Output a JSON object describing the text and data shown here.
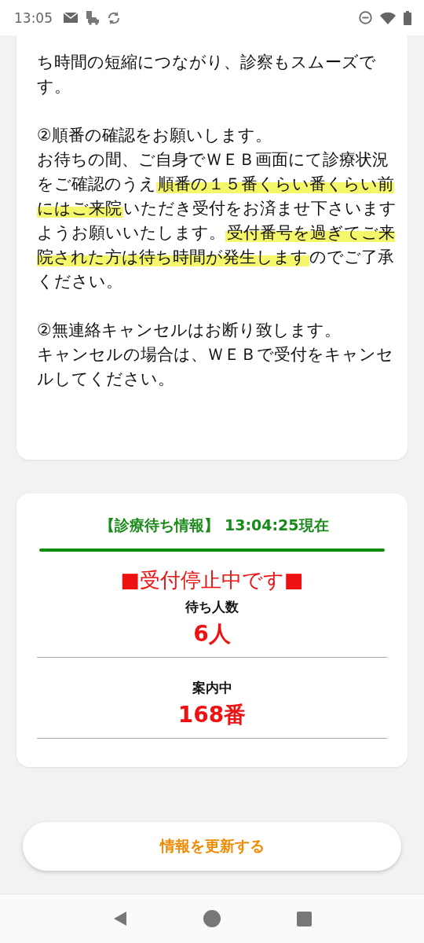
{
  "status_bar": {
    "time": "13:05"
  },
  "notice": {
    "blocks": [
      [
        {
          "segments": [
            {
              "text": "ち時間の短縮につながり、診察もスムーズです。",
              "highlighted": false
            }
          ]
        }
      ],
      [
        {
          "segments": [
            {
              "text": "②順番の確認をお願いします。",
              "highlighted": false
            }
          ]
        },
        {
          "segments": [
            {
              "text": "お待ちの間、ご自身でＷＥＢ画面にて診療状況をご確認のうえ",
              "highlighted": false
            },
            {
              "text": "順番の１５番くらい番くらい前にはご来院",
              "highlighted": true
            },
            {
              "text": "いただき受付をお済ませ下さいますようお願いいたします。",
              "highlighted": false
            },
            {
              "text": "受付番号を過ぎてご来院された方は待ち時間が発生します",
              "highlighted": true
            },
            {
              "text": "のでご了承ください。",
              "highlighted": false
            }
          ]
        }
      ],
      [
        {
          "segments": [
            {
              "text": "②無連絡キャンセルはお断り致します。",
              "highlighted": false
            }
          ]
        },
        {
          "segments": [
            {
              "text": "キャンセルの場合は、ＷＥＢで受付をキャンセルしてください。",
              "highlighted": false
            }
          ]
        }
      ]
    ]
  },
  "wait_info": {
    "title": "【診療待ち情報】 13:04:25現在",
    "status": "■受付停止中です■",
    "stats": [
      {
        "label": "待ち人数",
        "value": "6人"
      },
      {
        "label": "案内中",
        "value": "168番"
      }
    ]
  },
  "refresh_button": {
    "label": "情報を更新する"
  }
}
